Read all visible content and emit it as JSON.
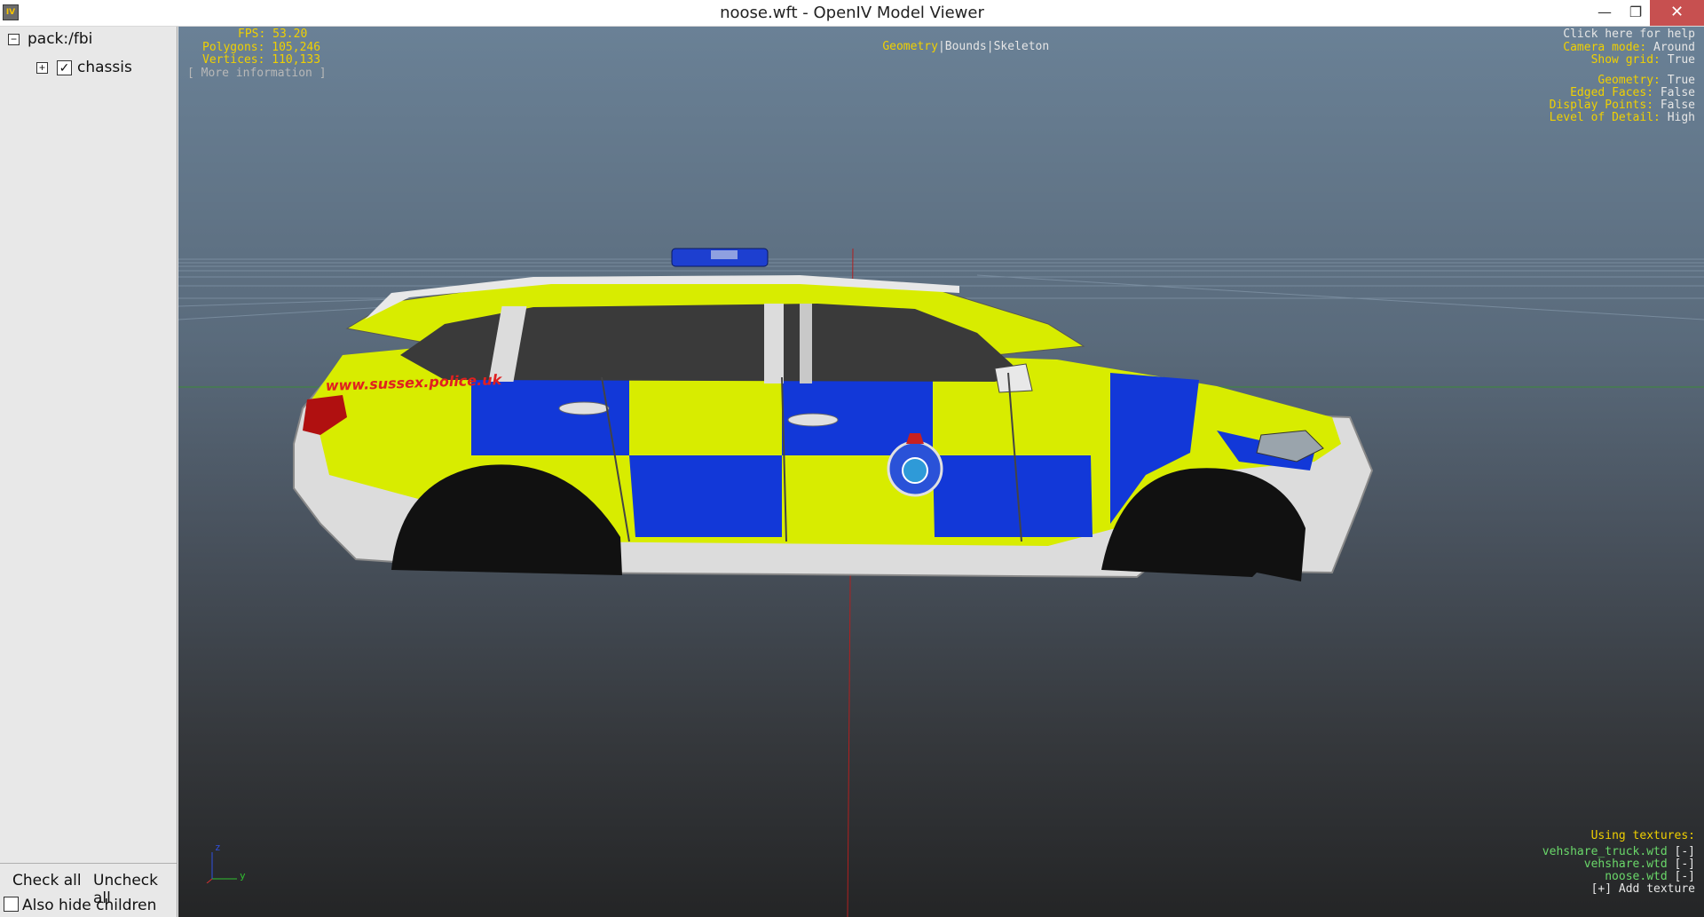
{
  "window": {
    "title": "noose.wft - OpenIV Model Viewer",
    "app_icon": "IV",
    "buttons": {
      "minimize": "—",
      "maximize": "❐",
      "close": "✕"
    }
  },
  "tree": {
    "root_label": "pack:/fbi",
    "root_toggle": "−",
    "child_label": "chassis",
    "child_toggle": "+",
    "child_checked": true,
    "check_mark": "✓"
  },
  "left_footer": {
    "check_all": "Check all",
    "uncheck_all": "Uncheck all",
    "also_hide_children": "Also hide children"
  },
  "hud": {
    "fps": "FPS: 53.20",
    "polygons": "Polygons: 105,246",
    "vertices": "Vertices: 110,133",
    "more_info": "[ More information ]",
    "modes": {
      "geometry": "Geometry",
      "sep1": "|",
      "bounds": "Bounds",
      "sep2": "|",
      "skeleton": "Skeleton"
    },
    "help": "Click here for help",
    "settings": [
      {
        "label": "Camera mode:",
        "value": "Around"
      },
      {
        "label": "Show grid:",
        "value": "True"
      },
      {
        "label": "Geometry:",
        "value": "True"
      },
      {
        "label": "Edged Faces:",
        "value": "False"
      },
      {
        "label": "Display Points:",
        "value": "False"
      },
      {
        "label": "Level of Detail:",
        "value": "High"
      }
    ],
    "textures_title": "Using textures:",
    "textures": [
      {
        "name": "vehshare_truck.wtd",
        "action": "[-]"
      },
      {
        "name": "vehshare.wtd",
        "action": "[-]"
      },
      {
        "name": "noose.wtd",
        "action": "[-]"
      }
    ],
    "add_texture": "[+] Add texture",
    "axis": {
      "z": "z",
      "y": "y"
    }
  },
  "car": {
    "url_text": "www.sussex.police.uk",
    "colors": {
      "yellow": "#d8ec00",
      "blue": "#1238d8",
      "white": "#e6e6e6",
      "window": "#3a3a3a"
    }
  }
}
